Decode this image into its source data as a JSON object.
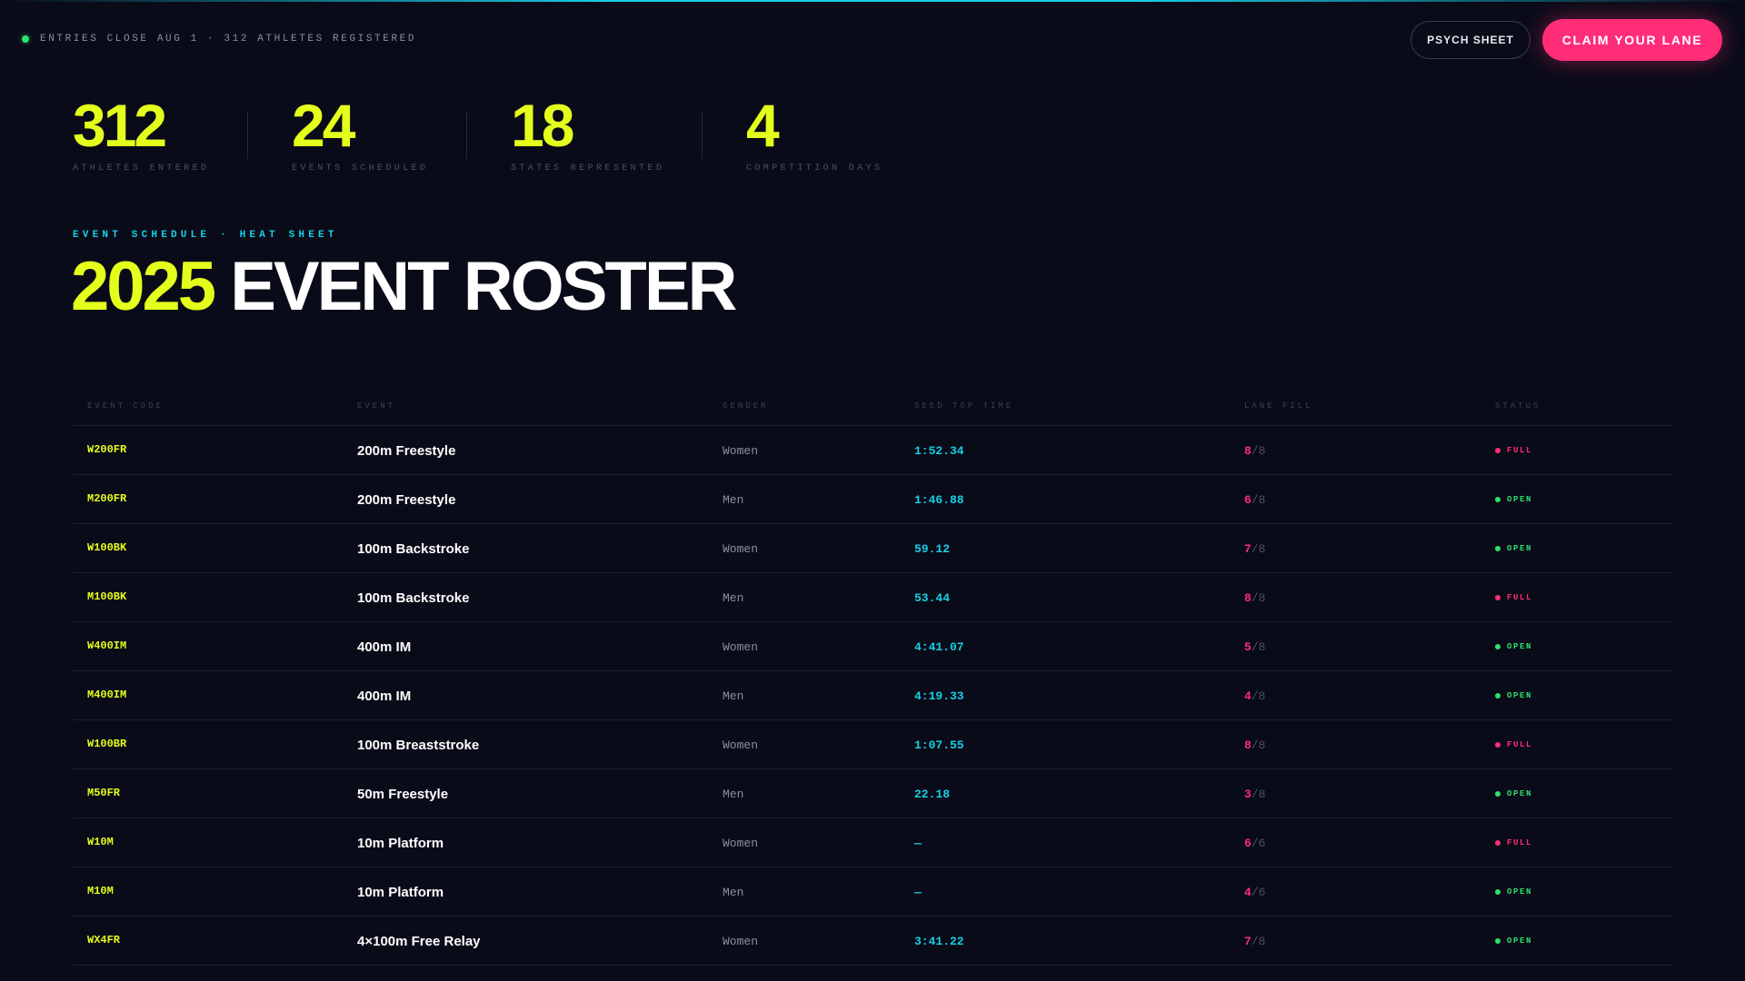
{
  "banner": {
    "entries_text": "ENTRIES CLOSE AUG 1 · 312 ATHLETES REGISTERED",
    "psych_sheet_label": "PSYCH SHEET",
    "claim_lane_label": "CLAIM YOUR LANE"
  },
  "stats": [
    {
      "value": "312",
      "label": "ATHLETES ENTERED"
    },
    {
      "value": "24",
      "label": "EVENTS SCHEDULED"
    },
    {
      "value": "18",
      "label": "STATES REPRESENTED"
    },
    {
      "value": "4",
      "label": "COMPETITION DAYS"
    }
  ],
  "section": {
    "eyebrow": "EVENT SCHEDULE · HEAT SHEET",
    "title_year": "2025",
    "title_rest": "EVENT ROSTER"
  },
  "table": {
    "columns": [
      "EVENT CODE",
      "EVENT",
      "GENDER",
      "SEED TOP TIME",
      "LANE FILL",
      "STATUS"
    ],
    "rows": [
      {
        "code": "W200FR",
        "event": "200m Freestyle",
        "gender": "Women",
        "seed": "1:52.34",
        "fill": "8",
        "lanes": "/8",
        "status": "FULL"
      },
      {
        "code": "M200FR",
        "event": "200m Freestyle",
        "gender": "Men",
        "seed": "1:46.88",
        "fill": "6",
        "lanes": "/8",
        "status": "OPEN"
      },
      {
        "code": "W100BK",
        "event": "100m Backstroke",
        "gender": "Women",
        "seed": "59.12",
        "fill": "7",
        "lanes": "/8",
        "status": "OPEN"
      },
      {
        "code": "M100BK",
        "event": "100m Backstroke",
        "gender": "Men",
        "seed": "53.44",
        "fill": "8",
        "lanes": "/8",
        "status": "FULL"
      },
      {
        "code": "W400IM",
        "event": "400m IM",
        "gender": "Women",
        "seed": "4:41.07",
        "fill": "5",
        "lanes": "/8",
        "status": "OPEN"
      },
      {
        "code": "M400IM",
        "event": "400m IM",
        "gender": "Men",
        "seed": "4:19.33",
        "fill": "4",
        "lanes": "/8",
        "status": "OPEN"
      },
      {
        "code": "W100BR",
        "event": "100m Breaststroke",
        "gender": "Women",
        "seed": "1:07.55",
        "fill": "8",
        "lanes": "/8",
        "status": "FULL"
      },
      {
        "code": "M50FR",
        "event": "50m Freestyle",
        "gender": "Men",
        "seed": "22.18",
        "fill": "3",
        "lanes": "/8",
        "status": "OPEN"
      },
      {
        "code": "W10M",
        "event": "10m Platform",
        "gender": "Women",
        "seed": "—",
        "fill": "6",
        "lanes": "/6",
        "status": "FULL"
      },
      {
        "code": "M10M",
        "event": "10m Platform",
        "gender": "Men",
        "seed": "—",
        "fill": "4",
        "lanes": "/6",
        "status": "OPEN"
      },
      {
        "code": "WX4FR",
        "event": "4×100m Free Relay",
        "gender": "Women",
        "seed": "3:41.22",
        "fill": "7",
        "lanes": "/8",
        "status": "OPEN"
      }
    ]
  },
  "colors": {
    "accent_yellow": "#e5ff1c",
    "accent_cyan": "#17cfe7",
    "accent_pink": "#ff2d78",
    "status_open": "#2fe06b",
    "background": "#0a0b18"
  }
}
